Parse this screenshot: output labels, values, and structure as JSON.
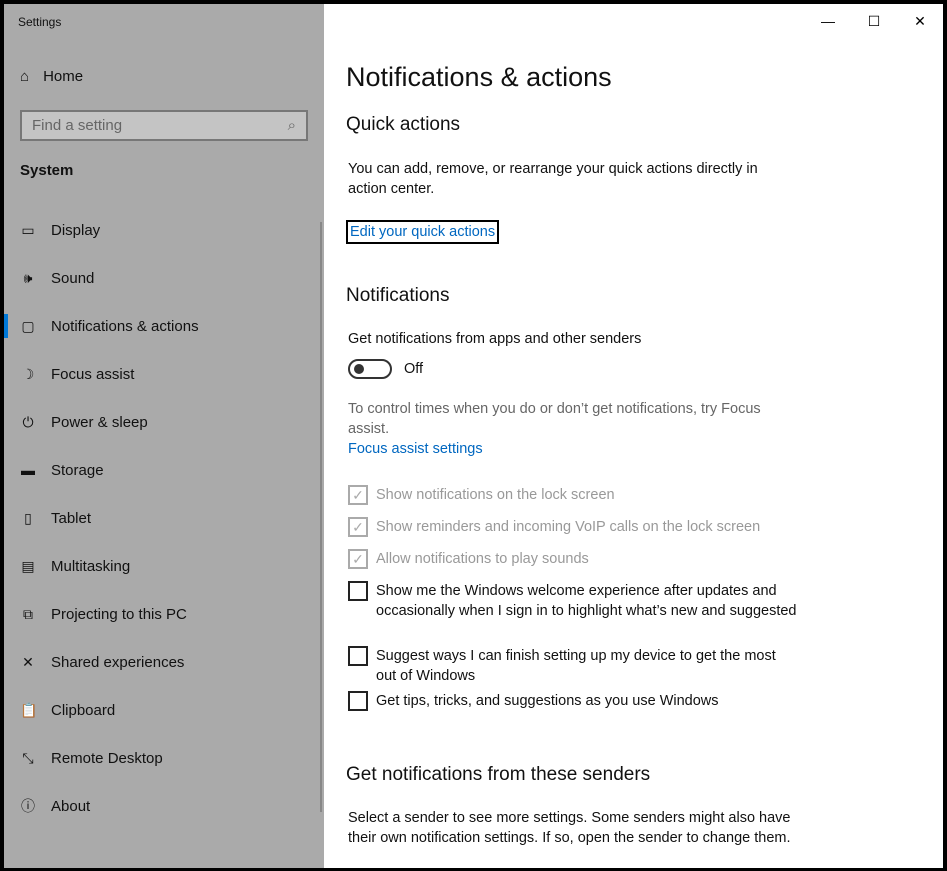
{
  "app_title": "Settings",
  "sidebar": {
    "home": "Home",
    "search_placeholder": "Find a setting",
    "section": "System",
    "items": [
      {
        "label": "Display",
        "icon": "▭"
      },
      {
        "label": "Sound",
        "icon": "🕪"
      },
      {
        "label": "Notifications & actions",
        "icon": "▢"
      },
      {
        "label": "Focus assist",
        "icon": "☽"
      },
      {
        "label": "Power & sleep",
        "icon": "⏻"
      },
      {
        "label": "Storage",
        "icon": "▬"
      },
      {
        "label": "Tablet",
        "icon": "▯"
      },
      {
        "label": "Multitasking",
        "icon": "▤"
      },
      {
        "label": "Projecting to this PC",
        "icon": "⧉"
      },
      {
        "label": "Shared experiences",
        "icon": "✕"
      },
      {
        "label": "Clipboard",
        "icon": "📋"
      },
      {
        "label": "Remote Desktop",
        "icon": "⤡"
      },
      {
        "label": "About",
        "icon": "ⓘ"
      }
    ]
  },
  "main": {
    "title": "Notifications & actions",
    "quick_actions": {
      "heading": "Quick actions",
      "desc": "You can add, remove, or rearrange your quick actions directly in action center.",
      "link": "Edit your quick actions"
    },
    "notifications": {
      "heading": "Notifications",
      "toggle_label": "Get notifications from apps and other senders",
      "toggle_state": "Off",
      "focus_desc": "To control times when you do or don’t get notifications, try Focus assist.",
      "focus_link": "Focus assist settings",
      "checkboxes": [
        {
          "label": "Show notifications on the lock screen",
          "checked": true,
          "disabled": true
        },
        {
          "label": "Show reminders and incoming VoIP calls on the lock screen",
          "checked": true,
          "disabled": true
        },
        {
          "label": "Allow notifications to play sounds",
          "checked": true,
          "disabled": true
        },
        {
          "label": "Show me the Windows welcome experience after updates and occasionally when I sign in to highlight what’s new and suggested",
          "checked": false,
          "disabled": false
        },
        {
          "label": "Suggest ways I can finish setting up my device to get the most out of Windows",
          "checked": false,
          "disabled": false
        },
        {
          "label": "Get tips, tricks, and suggestions as you use Windows",
          "checked": false,
          "disabled": false
        }
      ]
    },
    "senders": {
      "heading": "Get notifications from these senders",
      "desc": "Select a sender to see more settings. Some senders might also have their own notification settings. If so, open the sender to change them."
    }
  }
}
